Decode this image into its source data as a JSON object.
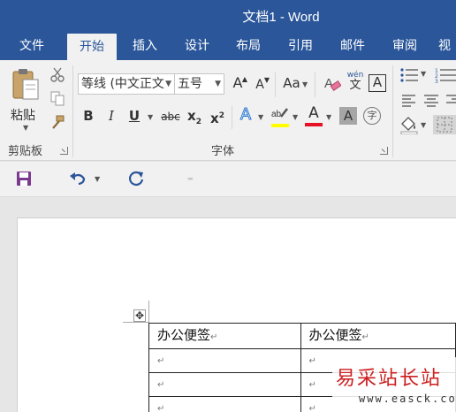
{
  "window": {
    "title": "文档1 - Word"
  },
  "tabs": [
    "文件",
    "开始",
    "插入",
    "设计",
    "布局",
    "引用",
    "邮件",
    "审阅",
    "视"
  ],
  "active_tab": "开始",
  "ribbon": {
    "clipboard": {
      "paste_label": "粘贴",
      "group_label": "剪贴板"
    },
    "font": {
      "font_name": "等线 (中文正文",
      "font_size": "五号",
      "grow_label": "A",
      "shrink_label": "A",
      "case_label": "Aa",
      "phonetic_top": "wén",
      "phonetic_bottom": "文",
      "border_char": "A",
      "bold": "B",
      "italic": "I",
      "underline": "U",
      "strike": "abc",
      "subscript": "x",
      "subscript_small": "2",
      "superscript": "x",
      "superscript_small": "2",
      "effects": "A",
      "font_color": "A",
      "char_shading": "A",
      "enclose": "字",
      "group_label": "字体",
      "highlight_color": "#ffff00",
      "font_color_value": "#e81123"
    }
  },
  "qat": {
    "save": "save-icon",
    "undo": "undo-icon",
    "repeat": "repeat-icon"
  },
  "document": {
    "move_handle": "✥",
    "table": {
      "headers": [
        "办公便签",
        "办公便签"
      ],
      "paragraph_mark": "↵"
    }
  },
  "watermark": {
    "text": "易采站长站",
    "url": "www.easck.com"
  },
  "colors": {
    "title_bar": "#2b579a",
    "ribbon_bg": "#f1f1f1",
    "accent": "#2b579a"
  }
}
